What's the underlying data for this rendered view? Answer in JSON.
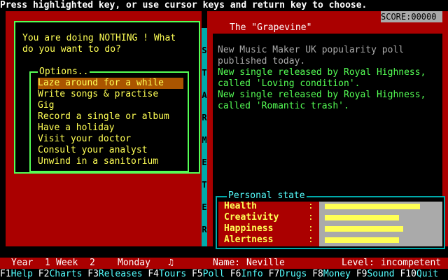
{
  "header": {
    "instruction": "Press highlighted key, or use cursor keys and return key to choose."
  },
  "score": {
    "label": "SCORE:00000"
  },
  "dialog": {
    "question_line1": "You are doing NOTHING ! What",
    "question_line2": "do you want to do?",
    "options_title": "Options..",
    "options": [
      {
        "label": "Laze around for a while",
        "selected": true
      },
      {
        "label": "Write songs & practise",
        "selected": false
      },
      {
        "label": "Gig",
        "selected": false
      },
      {
        "label": "Record a single or album",
        "selected": false
      },
      {
        "label": "Have a holiday",
        "selected": false
      },
      {
        "label": "Visit your doctor",
        "selected": false
      },
      {
        "label": "Consult your analyst",
        "selected": false
      },
      {
        "label": "Unwind in a sanitorium",
        "selected": false
      }
    ]
  },
  "strip_letters": [
    "S",
    "T",
    "A",
    "R",
    "M",
    "E",
    "T",
    "E",
    "R"
  ],
  "grapevine": {
    "title": "The \"Grapevine\"",
    "lines": [
      {
        "text": "New Music Maker UK popularity poll",
        "color": "#aaaaaa"
      },
      {
        "text": "published today.",
        "color": "#aaaaaa"
      },
      {
        "text": "New single released by Royal Highness,",
        "color": "#55ff55"
      },
      {
        "text": "called 'Loving condition'.",
        "color": "#55ff55"
      },
      {
        "text": "New single released by Royal Highness,",
        "color": "#55ff55"
      },
      {
        "text": "called 'Romantic trash'.",
        "color": "#55ff55"
      }
    ]
  },
  "personal_state": {
    "title": "Personal state",
    "stats": [
      {
        "label": "Health",
        "colon": ":",
        "level": 0.85
      },
      {
        "label": "Creativity",
        "colon": ":",
        "level": 0.66
      },
      {
        "label": "Happiness",
        "colon": ":",
        "level": 0.7
      },
      {
        "label": "Alertness",
        "colon": ":",
        "level": 0.66
      }
    ]
  },
  "status": {
    "year_label": "Year",
    "year": "1",
    "week_label": "Week",
    "week": "2",
    "day": "Monday",
    "note_glyph": "♫",
    "name_label": "Name:",
    "name": "Neville",
    "level_label": "Level:",
    "level": "incompetent"
  },
  "fkeys": [
    {
      "key": "F1",
      "label": "Help"
    },
    {
      "key": "F2",
      "label": "Charts"
    },
    {
      "key": "F3",
      "label": "Releases"
    },
    {
      "key": "F4",
      "label": "Tours"
    },
    {
      "key": "F5",
      "label": "Poll"
    },
    {
      "key": "F6",
      "label": "Info"
    },
    {
      "key": "F7",
      "label": "Drugs"
    },
    {
      "key": "F8",
      "label": "Money"
    },
    {
      "key": "F9",
      "label": "Sound"
    },
    {
      "key": "F10",
      "label": "Quit"
    }
  ],
  "colors": {
    "frame_red": "#aa0000",
    "highlight": "#aa5500",
    "text_yellow": "#ffff55",
    "border_green": "#55ff55",
    "cyan": "#00aaaa",
    "grey": "#aaaaaa"
  }
}
